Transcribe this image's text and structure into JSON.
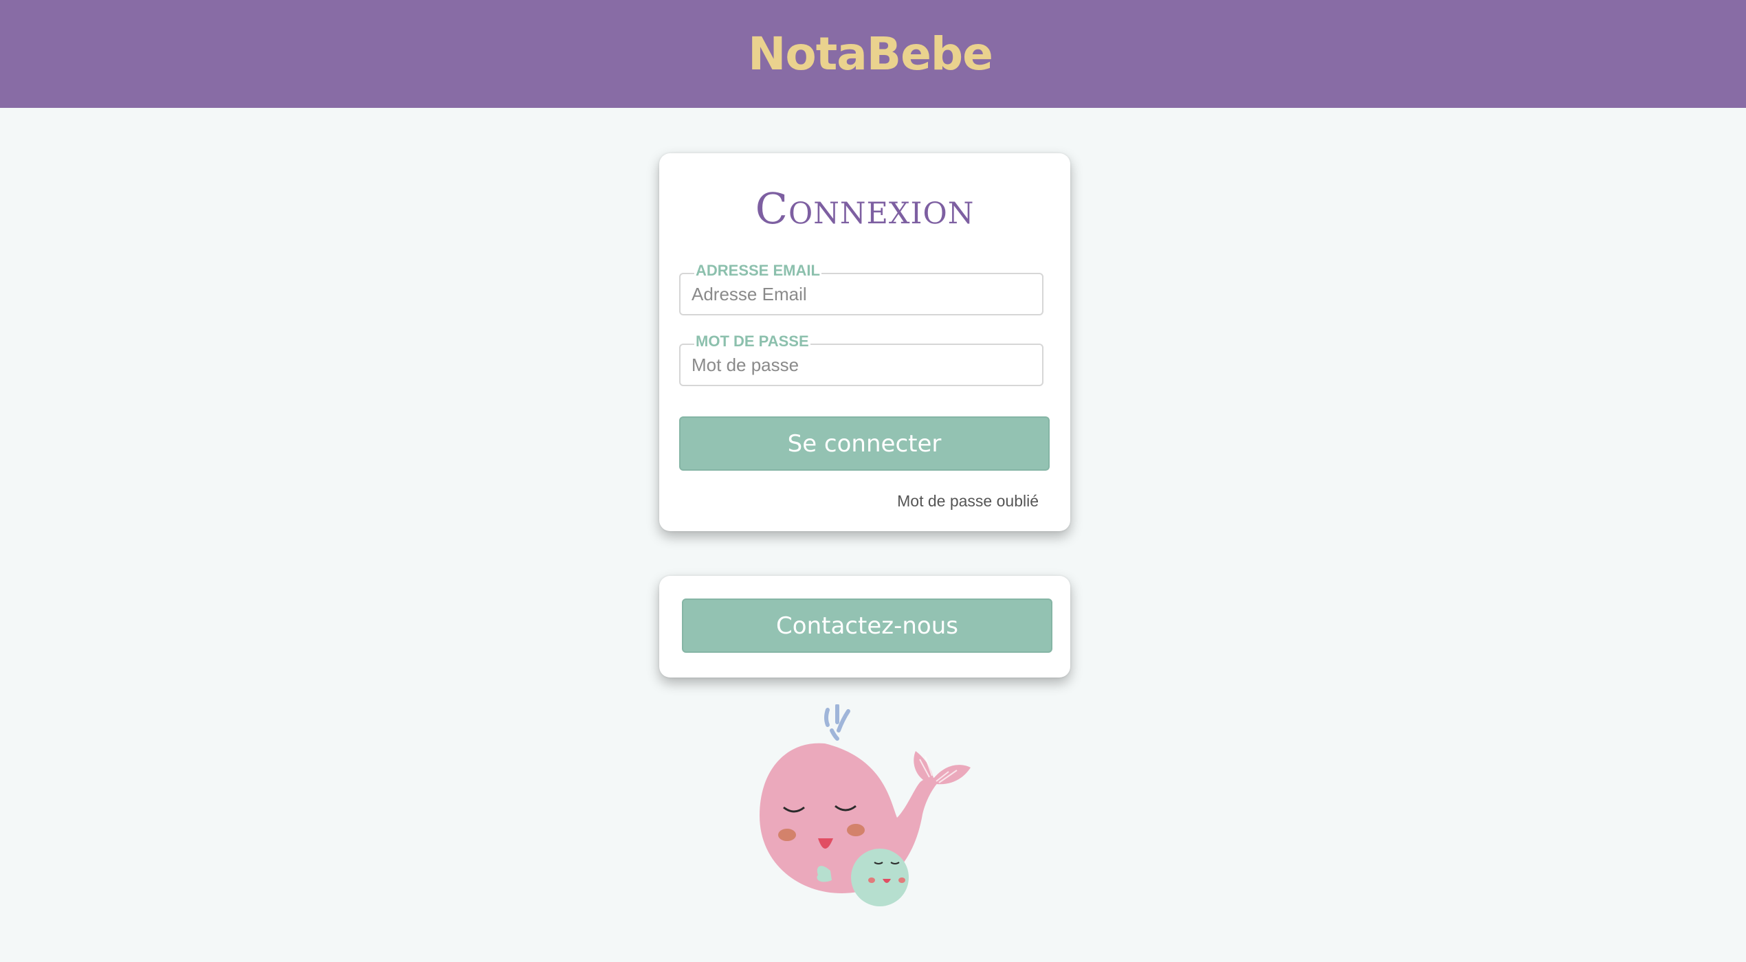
{
  "header": {
    "brand": "NotaBebe"
  },
  "login": {
    "title": "Connexion",
    "email_label": "ADRESSE EMAIL",
    "email_placeholder": "Adresse Email",
    "email_value": "",
    "password_label": "MOT DE PASSE",
    "password_placeholder": "Mot de passe",
    "password_value": "",
    "submit_label": "Se connecter",
    "forgot_label": "Mot de passe oublié"
  },
  "contact": {
    "button_label": "Contactez-nous"
  },
  "illustration": {
    "icon": "whale-mother-baby-icon"
  },
  "colors": {
    "header_bg": "#886ca5",
    "brand": "#ead28e",
    "accent": "#93c2b2",
    "title": "#7d5fa1",
    "page_bg": "#f4f8f8"
  }
}
